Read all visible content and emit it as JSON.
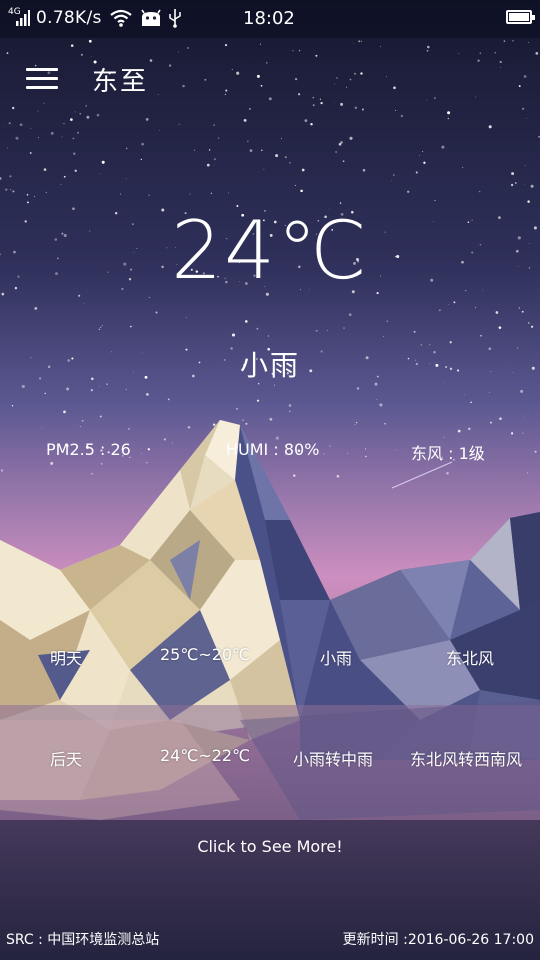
{
  "status_bar": {
    "network_type": "4G",
    "speed": "0.78K/s",
    "time": "18:02",
    "icons": [
      "signal-icon",
      "wifi-icon",
      "android-robot-icon",
      "usb-icon",
      "battery-icon"
    ],
    "battery_level": 1.0
  },
  "toolbar": {
    "menu_icon": "hamburger-menu-icon",
    "title": "东至"
  },
  "current": {
    "temperature": "24℃",
    "condition": "小雨",
    "pm25": "PM2.5 : 26",
    "humidity": "HUMI : 80%",
    "wind": "东风 : 1级"
  },
  "forecast": [
    {
      "day": "明天",
      "temp_range": "25℃~20℃",
      "weather": "小雨",
      "wind": "东北风"
    },
    {
      "day": "后天",
      "temp_range": "24℃~22℃",
      "weather": "小雨转中雨",
      "wind": "东北风转西南风"
    }
  ],
  "more_link": "Click to See More!",
  "footer": {
    "source": "SRC : 中国环境监测总站",
    "updated": "更新时间 :2016-06-26 17:00"
  },
  "colors": {
    "sky_top": "#181a36",
    "sky_mid": "#4a4c80",
    "horizon": "#c98bb8",
    "ground": "#7a5a80"
  }
}
